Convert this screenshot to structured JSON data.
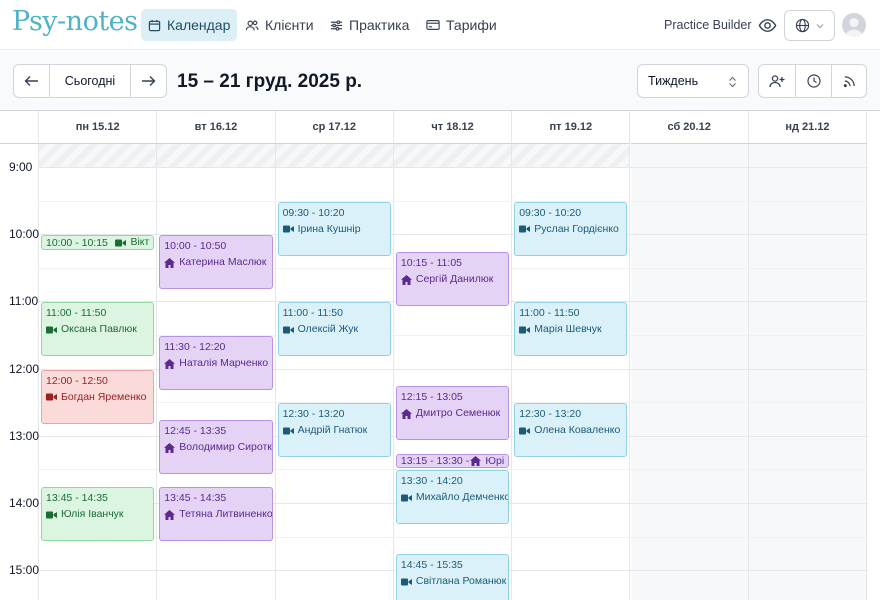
{
  "app": {
    "logo": "Psy-notes"
  },
  "nav": [
    {
      "id": "calendar",
      "label": "Календар",
      "icon": "calendar-icon",
      "active": true
    },
    {
      "id": "clients",
      "label": "Клієнти",
      "icon": "users-icon"
    },
    {
      "id": "practice",
      "label": "Практика",
      "icon": "sliders-icon"
    },
    {
      "id": "pricing",
      "label": "Тарифи",
      "icon": "card-icon"
    }
  ],
  "header": {
    "practice_builder": "Practice Builder"
  },
  "toolbar": {
    "today_label": "Сьогодні",
    "range_title": "15 – 21 груд. 2025 р.",
    "view_selected": "Тиждень"
  },
  "days": [
    "пн 15.12",
    "вт 16.12",
    "ср 17.12",
    "чт 18.12",
    "пт 19.12",
    "сб 20.12",
    "нд 21.12"
  ],
  "hours": [
    "9:00",
    "10:00",
    "11:00",
    "12:00",
    "13:00",
    "14:00",
    "15:00"
  ],
  "colors": {
    "accent": "#4fb3c8",
    "online": "#1c5b77",
    "inperson": "#5b2a8f",
    "green": "#1c6b35",
    "red": "#9b1f1f"
  },
  "events": [
    {
      "day": 0,
      "start": "10:00",
      "end": "10:15",
      "time": "10:00 - 10:15",
      "name": "Вікт",
      "kind": "video",
      "color": "green"
    },
    {
      "day": 0,
      "start": "11:00",
      "end": "11:50",
      "time": "11:00 - 11:50",
      "name": "Оксана Павлюк",
      "kind": "video",
      "color": "green"
    },
    {
      "day": 0,
      "start": "12:00",
      "end": "12:50",
      "time": "12:00 - 12:50",
      "name": "Богдан Яременко",
      "kind": "video",
      "color": "red"
    },
    {
      "day": 0,
      "start": "13:45",
      "end": "14:35",
      "time": "13:45 - 14:35",
      "name": "Юлія Іванчук",
      "kind": "video",
      "color": "green"
    },
    {
      "day": 1,
      "start": "10:00",
      "end": "10:50",
      "time": "10:00 - 10:50",
      "name": "Катерина Маслюк",
      "kind": "home",
      "color": "purple"
    },
    {
      "day": 1,
      "start": "11:30",
      "end": "12:20",
      "time": "11:30 - 12:20",
      "name": "Наталія Марченко",
      "kind": "home",
      "color": "purple"
    },
    {
      "day": 1,
      "start": "12:45",
      "end": "13:35",
      "time": "12:45 - 13:35",
      "name": "Володимир Сиротк",
      "kind": "home",
      "color": "purple"
    },
    {
      "day": 1,
      "start": "13:45",
      "end": "14:35",
      "time": "13:45 - 14:35",
      "name": "Тетяна Литвиненко",
      "kind": "home",
      "color": "purple"
    },
    {
      "day": 2,
      "start": "09:30",
      "end": "10:20",
      "time": "09:30 - 10:20",
      "name": "Ірина Кушнір",
      "kind": "video",
      "color": "blue"
    },
    {
      "day": 2,
      "start": "11:00",
      "end": "11:50",
      "time": "11:00 - 11:50",
      "name": "Олексій Жук",
      "kind": "video",
      "color": "blue"
    },
    {
      "day": 2,
      "start": "12:30",
      "end": "13:20",
      "time": "12:30 - 13:20",
      "name": "Андрій Гнатюк",
      "kind": "video",
      "color": "blue"
    },
    {
      "day": 3,
      "start": "10:15",
      "end": "11:05",
      "time": "10:15 - 11:05",
      "name": "Сергій Данилюк",
      "kind": "home",
      "color": "purple"
    },
    {
      "day": 3,
      "start": "12:15",
      "end": "13:05",
      "time": "12:15 - 13:05",
      "name": "Дмитро Семенюк",
      "kind": "home",
      "color": "purple"
    },
    {
      "day": 3,
      "start": "13:15",
      "end": "13:30",
      "time": "13:15 - 13:30 -",
      "name": "Юрі",
      "kind": "home",
      "color": "purple"
    },
    {
      "day": 3,
      "start": "13:30",
      "end": "14:20",
      "time": "13:30 - 14:20",
      "name": "Михайло Демченко",
      "kind": "video",
      "color": "blue"
    },
    {
      "day": 3,
      "start": "14:45",
      "end": "15:35",
      "time": "14:45 - 15:35",
      "name": "Світлана Романюк",
      "kind": "video",
      "color": "blue"
    },
    {
      "day": 4,
      "start": "09:30",
      "end": "10:20",
      "time": "09:30 - 10:20",
      "name": "Руслан Гордієнко",
      "kind": "video",
      "color": "blue"
    },
    {
      "day": 4,
      "start": "11:00",
      "end": "11:50",
      "time": "11:00 - 11:50",
      "name": "Марія Шевчук",
      "kind": "video",
      "color": "blue"
    },
    {
      "day": 4,
      "start": "12:30",
      "end": "13:20",
      "time": "12:30 - 13:20",
      "name": "Олена Коваленко",
      "kind": "video",
      "color": "blue"
    }
  ]
}
